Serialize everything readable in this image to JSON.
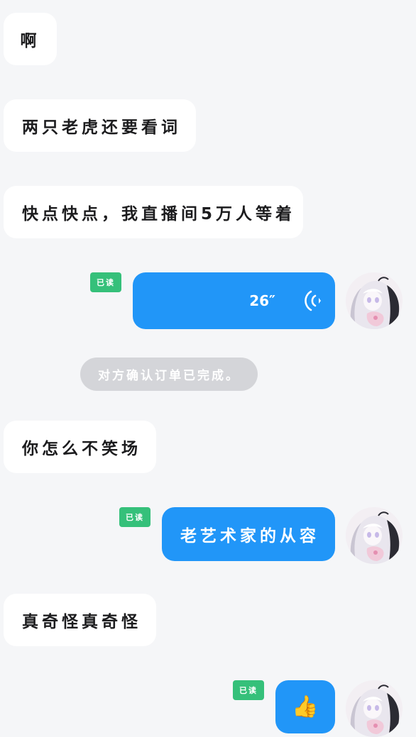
{
  "messages": [
    {
      "side": "in",
      "text": "啊"
    },
    {
      "side": "in",
      "text": "两只老虎还要看词"
    },
    {
      "side": "in",
      "text": "快点快点，我直播间5万人等着"
    },
    {
      "side": "out",
      "type": "voice",
      "duration": "26″",
      "read_label": "已读"
    },
    {
      "side": "system",
      "text": "对方确认订单已完成。"
    },
    {
      "side": "in",
      "text": "你怎么不笑场"
    },
    {
      "side": "out",
      "type": "text",
      "text": "老艺术家的从容",
      "read_label": "已读"
    },
    {
      "side": "in",
      "text": "真奇怪真奇怪"
    },
    {
      "side": "out",
      "type": "emoji",
      "text": "👍",
      "read_label": "已读"
    }
  ],
  "colors": {
    "background": "#f5f6f8",
    "incoming_bubble": "#ffffff",
    "outgoing_bubble": "#2196f8",
    "read_badge": "#35c07a",
    "system_pill": "#d4d5d9"
  },
  "icons": {
    "voice": "sound-wave-icon",
    "avatar": "anime-girl-avatar"
  }
}
